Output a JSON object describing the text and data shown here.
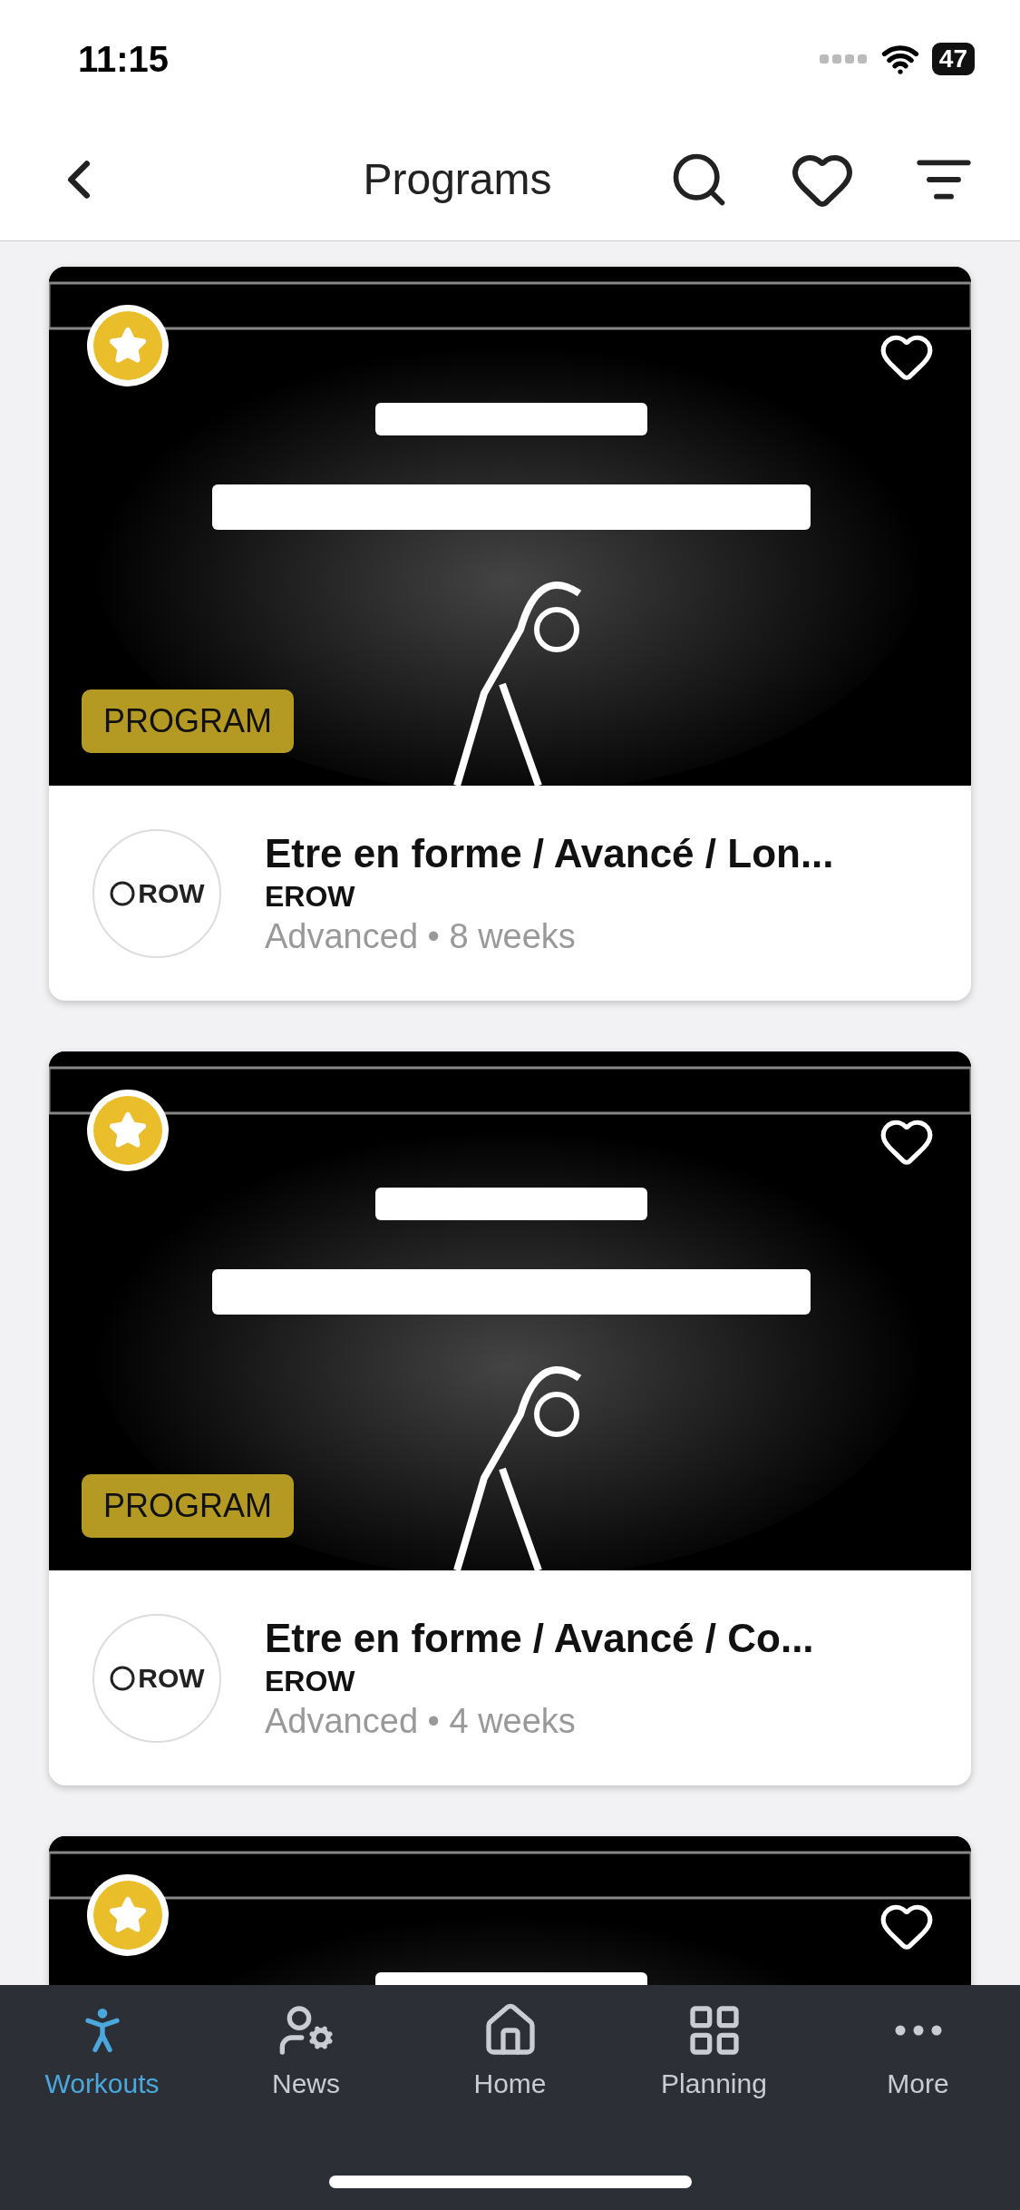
{
  "status_bar": {
    "time": "11:15",
    "battery": "47"
  },
  "header": {
    "title": "Programs"
  },
  "cards": [
    {
      "badge": "PROGRAM",
      "starred": true,
      "favorite": false,
      "title": "Etre en forme / Avancé / Lon...",
      "author": "EROW",
      "logo_text": "ROW",
      "meta": "Advanced • 8 weeks"
    },
    {
      "badge": "PROGRAM",
      "starred": true,
      "favorite": false,
      "title": "Etre en forme / Avancé / Co...",
      "author": "EROW",
      "logo_text": "ROW",
      "meta": "Advanced • 4 weeks"
    },
    {
      "starred": true,
      "favorite": false
    }
  ],
  "tabs": [
    {
      "kind": "workouts",
      "label": "Workouts",
      "selected": true
    },
    {
      "kind": "news",
      "label": "News",
      "selected": false
    },
    {
      "kind": "home",
      "label": "Home",
      "selected": false
    },
    {
      "kind": "planning",
      "label": "Planning",
      "selected": false
    },
    {
      "kind": "more",
      "label": "More",
      "selected": false
    }
  ]
}
